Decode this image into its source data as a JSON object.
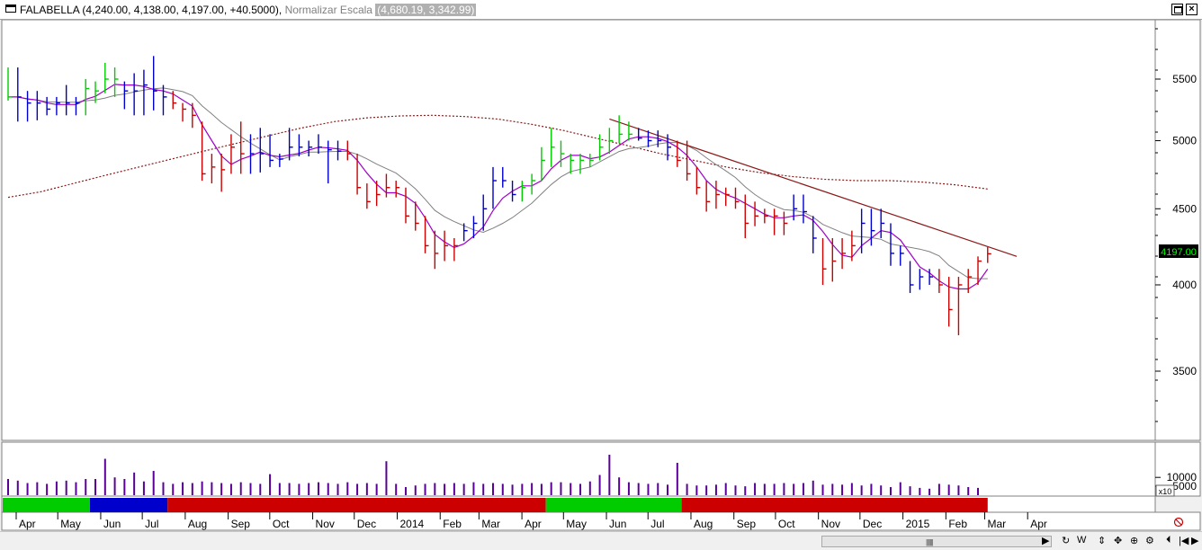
{
  "window": {
    "symbol": "FALABELLA",
    "ohlc_text": "(4,240.00, 4,138.00, 4,197.00, +40.5000),",
    "scale_label": "Normalizar Escala",
    "scale_range": "(4,680.19, 3,342.99)"
  },
  "price_axis": {
    "ticks": [
      "5500",
      "5000",
      "4500",
      "4000",
      "3500"
    ],
    "last_price_label": "4197.00",
    "last_price_color": "#00ff00",
    "scale": "log"
  },
  "volume_axis": {
    "ticks": [
      "10000",
      "5000"
    ],
    "multiplier_label": "x10"
  },
  "time_axis": {
    "labels": [
      "Apr",
      "May",
      "Jun",
      "Jul",
      "Aug",
      "Sep",
      "Oct",
      "Nov",
      "Dec",
      "2014",
      "Feb",
      "Mar",
      "Apr",
      "May",
      "Jun",
      "Jul",
      "Aug",
      "Sep",
      "Oct",
      "Nov",
      "Dec",
      "2015",
      "Feb",
      "Mar",
      "Apr"
    ]
  },
  "colors": {
    "up_bar": "#00cc00",
    "neutral_bar": "#0000cc",
    "down_bar": "#cc0000",
    "volume_bar": "#5a0096",
    "fast_ma": "#a000c8",
    "slow_ma": "#808080",
    "long_ma": "#8b1a1a",
    "trendline": "#8b1a1a"
  },
  "chart_data": {
    "type": "ohlc",
    "title": "FALABELLA",
    "price_scale": "log",
    "ylim": [
      3342.99,
      5700
    ],
    "x_range": [
      "2013-04",
      "2015-04"
    ],
    "period": "weekly",
    "bars": [
      {
        "week": "2013-03-25",
        "h": 5600,
        "l": 5320,
        "c": 5350,
        "t": "up"
      },
      {
        "week": "2013-04-01",
        "h": 5600,
        "l": 5150,
        "c": 5350,
        "t": "neutral"
      },
      {
        "week": "2013-04-08",
        "h": 5400,
        "l": 5150,
        "c": 5300,
        "t": "neutral"
      },
      {
        "week": "2013-04-15",
        "h": 5400,
        "l": 5160,
        "c": 5300,
        "t": "neutral"
      },
      {
        "week": "2013-04-22",
        "h": 5350,
        "l": 5200,
        "c": 5250,
        "t": "neutral"
      },
      {
        "week": "2013-04-29",
        "h": 5350,
        "l": 5200,
        "c": 5300,
        "t": "neutral"
      },
      {
        "week": "2013-05-06",
        "h": 5450,
        "l": 5200,
        "c": 5300,
        "t": "neutral"
      },
      {
        "week": "2013-05-13",
        "h": 5350,
        "l": 5200,
        "c": 5300,
        "t": "neutral"
      },
      {
        "week": "2013-05-20",
        "h": 5500,
        "l": 5200,
        "c": 5420,
        "t": "up"
      },
      {
        "week": "2013-05-27",
        "h": 5480,
        "l": 5300,
        "c": 5400,
        "t": "up"
      },
      {
        "week": "2013-06-03",
        "h": 5640,
        "l": 5380,
        "c": 5500,
        "t": "up"
      },
      {
        "week": "2013-06-10",
        "h": 5600,
        "l": 5350,
        "c": 5500,
        "t": "up"
      },
      {
        "week": "2013-06-17",
        "h": 5480,
        "l": 5250,
        "c": 5400,
        "t": "neutral"
      },
      {
        "week": "2013-06-24",
        "h": 5550,
        "l": 5200,
        "c": 5400,
        "t": "neutral"
      },
      {
        "week": "2013-07-01",
        "h": 5580,
        "l": 5200,
        "c": 5450,
        "t": "neutral"
      },
      {
        "week": "2013-07-08",
        "h": 5700,
        "l": 5240,
        "c": 5400,
        "t": "neutral"
      },
      {
        "week": "2013-07-15",
        "h": 5450,
        "l": 5200,
        "c": 5350,
        "t": "neutral"
      },
      {
        "week": "2013-07-22",
        "h": 5400,
        "l": 5250,
        "c": 5300,
        "t": "down"
      },
      {
        "week": "2013-07-29",
        "h": 5300,
        "l": 5150,
        "c": 5250,
        "t": "down"
      },
      {
        "week": "2013-08-05",
        "h": 5300,
        "l": 5100,
        "c": 5200,
        "t": "down"
      },
      {
        "week": "2013-08-12",
        "h": 5150,
        "l": 4700,
        "c": 4750,
        "t": "down"
      },
      {
        "week": "2013-08-19",
        "h": 4900,
        "l": 4680,
        "c": 4800,
        "t": "down"
      },
      {
        "week": "2013-08-26",
        "h": 4900,
        "l": 4620,
        "c": 4780,
        "t": "down"
      },
      {
        "week": "2013-09-02",
        "h": 5050,
        "l": 4750,
        "c": 4950,
        "t": "down"
      },
      {
        "week": "2013-09-09",
        "h": 5150,
        "l": 4750,
        "c": 4900,
        "t": "down"
      },
      {
        "week": "2013-09-16",
        "h": 5050,
        "l": 4750,
        "c": 4900,
        "t": "neutral"
      },
      {
        "week": "2013-09-23",
        "h": 5100,
        "l": 4760,
        "c": 4900,
        "t": "neutral"
      },
      {
        "week": "2013-09-30",
        "h": 5050,
        "l": 4800,
        "c": 4850,
        "t": "neutral"
      },
      {
        "week": "2013-10-07",
        "h": 4900,
        "l": 4800,
        "c": 4860,
        "t": "neutral"
      },
      {
        "week": "2013-10-14",
        "h": 5100,
        "l": 4850,
        "c": 4950,
        "t": "neutral"
      },
      {
        "week": "2013-10-21",
        "h": 5050,
        "l": 4880,
        "c": 4950,
        "t": "neutral"
      },
      {
        "week": "2013-10-28",
        "h": 5000,
        "l": 4880,
        "c": 4950,
        "t": "neutral"
      },
      {
        "week": "2013-11-04",
        "h": 5050,
        "l": 4900,
        "c": 4950,
        "t": "neutral"
      },
      {
        "week": "2013-11-11",
        "h": 5000,
        "l": 4680,
        "c": 4930,
        "t": "neutral"
      },
      {
        "week": "2013-11-18",
        "h": 5000,
        "l": 4850,
        "c": 4920,
        "t": "neutral"
      },
      {
        "week": "2013-11-25",
        "h": 5000,
        "l": 4850,
        "c": 4900,
        "t": "down"
      },
      {
        "week": "2013-12-02",
        "h": 4900,
        "l": 4600,
        "c": 4650,
        "t": "down"
      },
      {
        "week": "2013-12-09",
        "h": 4680,
        "l": 4500,
        "c": 4550,
        "t": "down"
      },
      {
        "week": "2013-12-16",
        "h": 4700,
        "l": 4520,
        "c": 4600,
        "t": "down"
      },
      {
        "week": "2013-12-23",
        "h": 4750,
        "l": 4580,
        "c": 4650,
        "t": "down"
      },
      {
        "week": "2013-12-30",
        "h": 4700,
        "l": 4580,
        "c": 4650,
        "t": "down"
      },
      {
        "week": "2014-01-06",
        "h": 4650,
        "l": 4400,
        "c": 4450,
        "t": "down"
      },
      {
        "week": "2014-01-13",
        "h": 4550,
        "l": 4350,
        "c": 4400,
        "t": "down"
      },
      {
        "week": "2014-01-20",
        "h": 4450,
        "l": 4200,
        "c": 4250,
        "t": "down"
      },
      {
        "week": "2014-01-27",
        "h": 4350,
        "l": 4100,
        "c": 4200,
        "t": "down"
      },
      {
        "week": "2014-02-03",
        "h": 4350,
        "l": 4150,
        "c": 4250,
        "t": "down"
      },
      {
        "week": "2014-02-10",
        "h": 4300,
        "l": 4150,
        "c": 4250,
        "t": "down"
      },
      {
        "week": "2014-02-17",
        "h": 4400,
        "l": 4280,
        "c": 4350,
        "t": "neutral"
      },
      {
        "week": "2014-02-24",
        "h": 4450,
        "l": 4300,
        "c": 4400,
        "t": "neutral"
      },
      {
        "week": "2014-03-03",
        "h": 4600,
        "l": 4350,
        "c": 4500,
        "t": "neutral"
      },
      {
        "week": "2014-03-10",
        "h": 4800,
        "l": 4500,
        "c": 4700,
        "t": "neutral"
      },
      {
        "week": "2014-03-17",
        "h": 4800,
        "l": 4650,
        "c": 4700,
        "t": "neutral"
      },
      {
        "week": "2014-03-24",
        "h": 4700,
        "l": 4550,
        "c": 4600,
        "t": "neutral"
      },
      {
        "week": "2014-03-31",
        "h": 4700,
        "l": 4550,
        "c": 4650,
        "t": "up"
      },
      {
        "week": "2014-04-07",
        "h": 4750,
        "l": 4600,
        "c": 4700,
        "t": "up"
      },
      {
        "week": "2014-04-14",
        "h": 4950,
        "l": 4700,
        "c": 4850,
        "t": "up"
      },
      {
        "week": "2014-04-21",
        "h": 5100,
        "l": 4800,
        "c": 4950,
        "t": "up"
      },
      {
        "week": "2014-04-28",
        "h": 5000,
        "l": 4800,
        "c": 4900,
        "t": "up"
      },
      {
        "week": "2014-05-05",
        "h": 4900,
        "l": 4750,
        "c": 4850,
        "t": "up"
      },
      {
        "week": "2014-05-12",
        "h": 4900,
        "l": 4750,
        "c": 4850,
        "t": "up"
      },
      {
        "week": "2014-05-19",
        "h": 4900,
        "l": 4800,
        "c": 4850,
        "t": "up"
      },
      {
        "week": "2014-05-26",
        "h": 5050,
        "l": 4850,
        "c": 4950,
        "t": "up"
      },
      {
        "week": "2014-06-02",
        "h": 5100,
        "l": 4900,
        "c": 5000,
        "t": "up"
      },
      {
        "week": "2014-06-09",
        "h": 5200,
        "l": 4980,
        "c": 5050,
        "t": "up"
      },
      {
        "week": "2014-06-16",
        "h": 5150,
        "l": 5000,
        "c": 5050,
        "t": "up"
      },
      {
        "week": "2014-06-23",
        "h": 5100,
        "l": 5000,
        "c": 5020,
        "t": "neutral"
      },
      {
        "week": "2014-06-30",
        "h": 5080,
        "l": 4950,
        "c": 5000,
        "t": "neutral"
      },
      {
        "week": "2014-07-07",
        "h": 5080,
        "l": 4950,
        "c": 5000,
        "t": "neutral"
      },
      {
        "week": "2014-07-14",
        "h": 5050,
        "l": 4850,
        "c": 4950,
        "t": "neutral"
      },
      {
        "week": "2014-07-21",
        "h": 5000,
        "l": 4800,
        "c": 4850,
        "t": "down"
      },
      {
        "week": "2014-07-28",
        "h": 5000,
        "l": 4700,
        "c": 4750,
        "t": "down"
      },
      {
        "week": "2014-08-04",
        "h": 4800,
        "l": 4600,
        "c": 4650,
        "t": "down"
      },
      {
        "week": "2014-08-11",
        "h": 4700,
        "l": 4480,
        "c": 4550,
        "t": "down"
      },
      {
        "week": "2014-08-18",
        "h": 4700,
        "l": 4500,
        "c": 4600,
        "t": "down"
      },
      {
        "week": "2014-08-25",
        "h": 4650,
        "l": 4520,
        "c": 4600,
        "t": "down"
      },
      {
        "week": "2014-09-01",
        "h": 4650,
        "l": 4500,
        "c": 4550,
        "t": "down"
      },
      {
        "week": "2014-09-08",
        "h": 4600,
        "l": 4300,
        "c": 4400,
        "t": "down"
      },
      {
        "week": "2014-09-15",
        "h": 4550,
        "l": 4380,
        "c": 4450,
        "t": "down"
      },
      {
        "week": "2014-09-22",
        "h": 4500,
        "l": 4400,
        "c": 4450,
        "t": "down"
      },
      {
        "week": "2014-09-29",
        "h": 4500,
        "l": 4320,
        "c": 4450,
        "t": "down"
      },
      {
        "week": "2014-10-06",
        "h": 4480,
        "l": 4320,
        "c": 4400,
        "t": "down"
      },
      {
        "week": "2014-10-13",
        "h": 4600,
        "l": 4420,
        "c": 4500,
        "t": "neutral"
      },
      {
        "week": "2014-10-20",
        "h": 4600,
        "l": 4400,
        "c": 4480,
        "t": "neutral"
      },
      {
        "week": "2014-10-27",
        "h": 4450,
        "l": 4200,
        "c": 4300,
        "t": "neutral"
      },
      {
        "week": "2014-11-03",
        "h": 4300,
        "l": 4000,
        "c": 4100,
        "t": "down"
      },
      {
        "week": "2014-11-10",
        "h": 4300,
        "l": 4020,
        "c": 4150,
        "t": "down"
      },
      {
        "week": "2014-11-17",
        "h": 4300,
        "l": 4100,
        "c": 4200,
        "t": "down"
      },
      {
        "week": "2014-11-24",
        "h": 4350,
        "l": 4150,
        "c": 4250,
        "t": "down"
      },
      {
        "week": "2014-12-01",
        "h": 4500,
        "l": 4200,
        "c": 4400,
        "t": "neutral"
      },
      {
        "week": "2014-12-08",
        "h": 4500,
        "l": 4250,
        "c": 4350,
        "t": "neutral"
      },
      {
        "week": "2014-12-15",
        "h": 4500,
        "l": 4300,
        "c": 4400,
        "t": "neutral"
      },
      {
        "week": "2014-12-22",
        "h": 4400,
        "l": 4120,
        "c": 4200,
        "t": "neutral"
      },
      {
        "week": "2014-12-29",
        "h": 4250,
        "l": 4120,
        "c": 4200,
        "t": "neutral"
      },
      {
        "week": "2015-01-05",
        "h": 4150,
        "l": 3950,
        "c": 4000,
        "t": "neutral"
      },
      {
        "week": "2015-01-12",
        "h": 4100,
        "l": 3970,
        "c": 4050,
        "t": "neutral"
      },
      {
        "week": "2015-01-19",
        "h": 4100,
        "l": 4000,
        "c": 4050,
        "t": "neutral"
      },
      {
        "week": "2015-01-26",
        "h": 4100,
        "l": 3950,
        "c": 4000,
        "t": "down"
      },
      {
        "week": "2015-02-02",
        "h": 4050,
        "l": 3750,
        "c": 3850,
        "t": "down"
      },
      {
        "week": "2015-02-09",
        "h": 4050,
        "l": 3700,
        "c": 4000,
        "t": "down"
      },
      {
        "week": "2015-02-16",
        "h": 4100,
        "l": 3950,
        "c": 4050,
        "t": "down"
      },
      {
        "week": "2015-02-23",
        "h": 4180,
        "l": 4000,
        "c": 4150,
        "t": "down"
      },
      {
        "week": "2015-03-02",
        "h": 4240,
        "l": 4138,
        "c": 4197,
        "t": "down"
      }
    ],
    "volume": [
      20,
      18,
      15,
      16,
      14,
      17,
      18,
      16,
      20,
      20,
      45,
      22,
      20,
      28,
      17,
      30,
      16,
      14,
      16,
      15,
      17,
      16,
      15,
      14,
      16,
      15,
      14,
      26,
      15,
      15,
      14,
      15,
      16,
      15,
      14,
      16,
      14,
      15,
      14,
      42,
      14,
      10,
      12,
      14,
      15,
      14,
      15,
      14,
      16,
      14,
      15,
      14,
      13,
      14,
      15,
      14,
      16,
      16,
      15,
      14,
      17,
      25,
      50,
      22,
      16,
      15,
      14,
      15,
      13,
      40,
      14,
      12,
      12,
      13,
      15,
      12,
      11,
      15,
      14,
      14,
      15,
      14,
      15,
      18,
      13,
      14,
      13,
      15,
      12,
      14,
      12,
      10,
      16,
      11,
      9,
      8,
      14,
      13,
      12,
      10,
      9
    ],
    "bands": [
      {
        "from": "2013-03-25",
        "to": "2013-05-27",
        "t": "up"
      },
      {
        "from": "2013-05-27",
        "to": "2013-07-22",
        "t": "neutral"
      },
      {
        "from": "2013-07-22",
        "to": "2014-04-21",
        "t": "down"
      },
      {
        "from": "2014-04-21",
        "to": "2014-07-28",
        "t": "up"
      },
      {
        "from": "2014-07-28",
        "to": "2015-03-02",
        "t": "down"
      }
    ],
    "trendline": {
      "from": {
        "week": "2014-06-02",
        "price": 5170
      },
      "to": {
        "week": "2015-03-23",
        "price": 4180
      }
    },
    "long_ma": [
      4580,
      4620,
      4680,
      4740,
      4800,
      4860,
      4920,
      4980,
      5040,
      5100,
      5150,
      5180,
      5195,
      5200,
      5190,
      5170,
      5130,
      5080,
      5020,
      4960,
      4900,
      4850,
      4800,
      4760,
      4730,
      4710,
      4700,
      4700,
      4690,
      4670,
      4640
    ]
  }
}
